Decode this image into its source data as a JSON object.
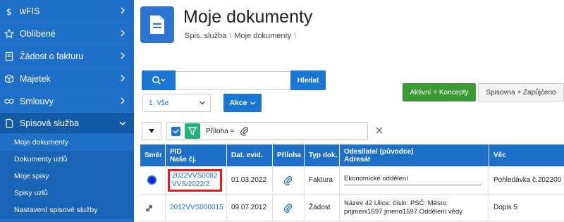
{
  "sidebar": {
    "items": [
      {
        "label": "wFIS",
        "icon": "dollar-icon"
      },
      {
        "label": "Oblíbené",
        "icon": "star-icon"
      },
      {
        "label": "Žádost o fakturu",
        "icon": "document-icon"
      },
      {
        "label": "Majetek",
        "icon": "box-icon"
      },
      {
        "label": "Smlouvy",
        "icon": "handshake-icon"
      },
      {
        "label": "Spisová služba",
        "icon": "file-icon"
      }
    ],
    "sub_items": [
      "Moje dokumenty",
      "Dokumenty uzlů",
      "Moje spisy",
      "Spisy uzlů",
      "Nastavení spisové služby"
    ]
  },
  "header": {
    "title": "Moje dokumenty",
    "breadcrumb": [
      "Spis. služba",
      "Moje dokumenty"
    ]
  },
  "toolbar": {
    "search_placeholder": "",
    "search_button": "Hledat",
    "btn_active": "Aktivní + Koncepty",
    "btn_spisovna": "Spisovna + Zapůjčeno",
    "select_value": "1. Vše",
    "akce": "Akce"
  },
  "filter": {
    "text": "Příloha ="
  },
  "table": {
    "headers": {
      "smer": "Směr",
      "pid": "PID",
      "nase_cj": "Naše čj.",
      "dat_evid": "Dat. evid.",
      "priloha": "Příloha",
      "typ_dok": "Typ dok.",
      "odesilatel": "Odesilatel (původce)",
      "adresat": "Adresát",
      "vec": "Věc"
    },
    "rows": [
      {
        "pid": "2022VVS0082",
        "cj": "VVS/2022/2",
        "date": "01.03.2022",
        "typ": "Faktura",
        "odes": "Ekonomické oddělení",
        "odes2": "",
        "vec": "Pohledávka č.202200"
      },
      {
        "pid": "2012VVS000015",
        "cj": "",
        "date": "09.07.2012",
        "typ": "Žádost",
        "odes": "Název 42 Ulice: číslo: PSČ: Město:",
        "odes2": "prijmeni1597 jmeno1597 Oddělení vědy",
        "vec": "Dopis 5"
      }
    ]
  },
  "colors": {
    "sidebar": "#1e6fc8",
    "primary": "#1976d2",
    "green": "#3a9a34",
    "highlight": "#e21b1b"
  }
}
